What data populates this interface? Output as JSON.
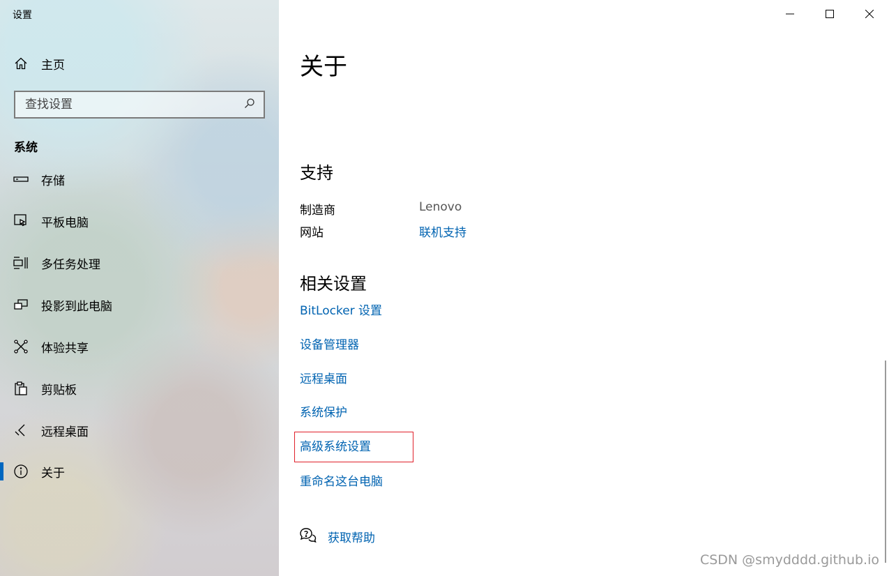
{
  "window": {
    "title": "设置"
  },
  "sidebar": {
    "home_label": "主页",
    "search": {
      "placeholder": "查找设置",
      "value": ""
    },
    "section_label": "系统",
    "items": [
      {
        "label": "存储",
        "icon": "storage-icon"
      },
      {
        "label": "平板电脑",
        "icon": "tablet-icon"
      },
      {
        "label": "多任务处理",
        "icon": "multitasking-icon"
      },
      {
        "label": "投影到此电脑",
        "icon": "projecting-icon"
      },
      {
        "label": "体验共享",
        "icon": "shared-experiences-icon"
      },
      {
        "label": "剪贴板",
        "icon": "clipboard-icon"
      },
      {
        "label": "远程桌面",
        "icon": "remote-desktop-icon"
      },
      {
        "label": "关于",
        "icon": "info-icon",
        "active": true
      }
    ]
  },
  "main": {
    "title": "关于",
    "support": {
      "heading": "支持",
      "manufacturer_label": "制造商",
      "manufacturer_value": "Lenovo",
      "website_label": "网站",
      "website_value": "联机支持"
    },
    "related": {
      "heading": "相关设置",
      "links": [
        "BitLocker 设置",
        "设备管理器",
        "远程桌面",
        "系统保护",
        "高级系统设置",
        "重命名这台电脑"
      ]
    },
    "help_label": "获取帮助"
  },
  "watermark": "CSDN @smydddd.github.io",
  "colors": {
    "accent": "#0067c0",
    "link": "#0063b1",
    "highlight": "#e0202a"
  }
}
